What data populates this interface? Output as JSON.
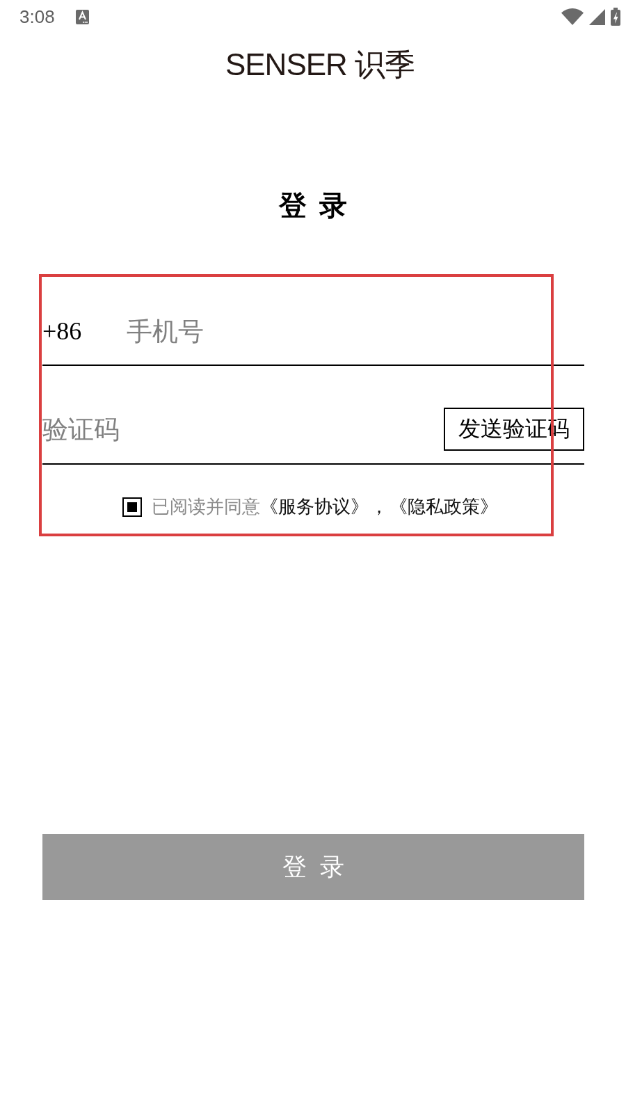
{
  "status_bar": {
    "time": "3:08"
  },
  "header": {
    "logo": "SENSER 识季"
  },
  "title": "登 录",
  "form": {
    "highlighted": true,
    "phone": {
      "country_code": "+86",
      "placeholder": "手机号"
    },
    "code": {
      "placeholder": "验证码",
      "send_button": "发送验证码"
    },
    "agreement": {
      "checked": true,
      "text": "已阅读并同意",
      "links": [
        "《服务协议》",
        "《隐私政策》"
      ],
      "separator": "，"
    }
  },
  "login_button": {
    "label": "登 录",
    "disabled": true
  }
}
